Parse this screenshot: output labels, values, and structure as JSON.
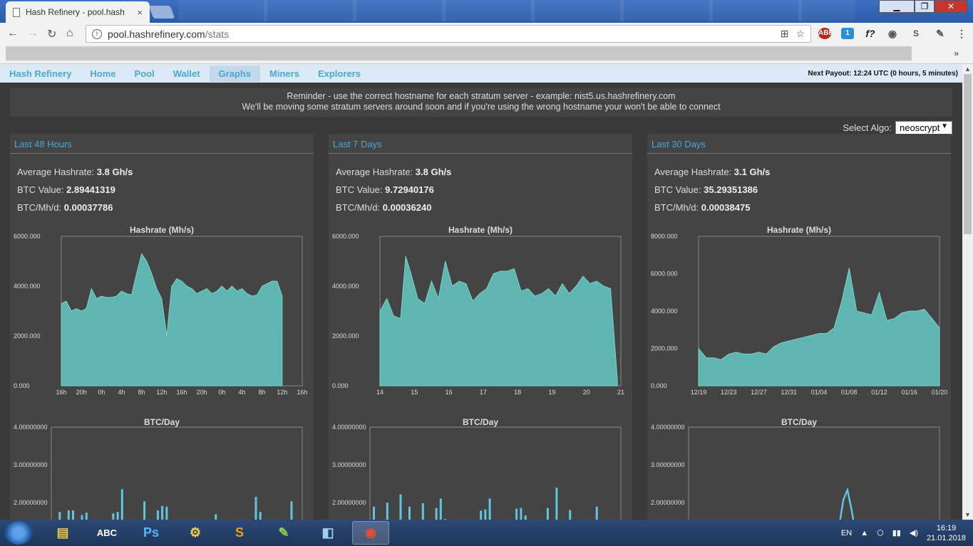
{
  "browser": {
    "tab_title": "Hash Refinery - pool.hash",
    "tab_close": "×",
    "url_host": "pool.hashrefinery.com",
    "url_path": "/stats",
    "bookmarks_overflow": "»"
  },
  "nav": {
    "brand": "Hash Refinery",
    "items": [
      "Home",
      "Pool",
      "Wallet",
      "Graphs",
      "Miners",
      "Explorers"
    ],
    "active": "Graphs",
    "payout": "Next Payout: 12:24 UTC (0 hours, 5 minutes)"
  },
  "reminder": {
    "line1": "Reminder - use the correct hostname for each stratum server - example: nist5.us.hashrefinery.com",
    "line2": "We'll be moving some stratum servers around soon and if you're using the wrong hostname your won't be able to connect"
  },
  "algo": {
    "label": "Select Algo:",
    "value": "neoscrypt",
    "arrow": "▼"
  },
  "panels": [
    {
      "title": "Last 48 Hours",
      "avg_label": "Average Hashrate:",
      "avg_value": "3.8 Gh/s",
      "btc_label": "BTC Value:",
      "btc_value": "2.89441319",
      "mhd_label": "BTC/Mh/d:",
      "mhd_value": "0.00037786"
    },
    {
      "title": "Last 7 Days",
      "avg_label": "Average Hashrate:",
      "avg_value": "3.8 Gh/s",
      "btc_label": "BTC Value:",
      "btc_value": "9.72940176",
      "mhd_label": "BTC/Mh/d:",
      "mhd_value": "0.00036240"
    },
    {
      "title": "Last 30 Days",
      "avg_label": "Average Hashrate:",
      "avg_value": "3.1 Gh/s",
      "btc_label": "BTC Value:",
      "btc_value": "35.29351386",
      "mhd_label": "BTC/Mh/d:",
      "mhd_value": "0.00038475"
    }
  ],
  "chart_data": [
    {
      "type": "area",
      "title": "Hashrate (Mh/s)",
      "ylim": [
        0,
        6000
      ],
      "yticks": [
        "0.000",
        "2000.000",
        "4000.000",
        "6000.000"
      ],
      "xticks": [
        "16h",
        "20h",
        "0h",
        "4h",
        "8h",
        "12h",
        "16h",
        "20h",
        "0h",
        "4h",
        "8h",
        "12h",
        "16h"
      ],
      "x_range": [
        0,
        48
      ],
      "x": [
        0,
        1,
        2,
        3,
        4,
        5,
        6,
        7,
        8,
        9,
        10,
        11,
        12,
        13,
        14,
        15,
        16,
        17,
        18,
        19,
        20,
        21,
        22,
        23,
        24,
        25,
        26,
        27,
        28,
        29,
        30,
        31,
        32,
        33,
        34,
        35,
        36,
        37,
        38,
        39,
        40,
        41,
        42,
        43,
        44
      ],
      "values": [
        3300,
        3400,
        3000,
        3100,
        3000,
        3100,
        3900,
        3500,
        3600,
        3550,
        3550,
        3600,
        3800,
        3700,
        3650,
        4500,
        5300,
        5000,
        4500,
        3900,
        3500,
        2000,
        4000,
        4300,
        4200,
        4000,
        3900,
        3700,
        3800,
        3900,
        3700,
        3800,
        4000,
        3800,
        4000,
        3800,
        3900,
        3700,
        3600,
        3650,
        4000,
        4100,
        4200,
        4200,
        3600
      ],
      "color": "#5fb6b0"
    },
    {
      "type": "area",
      "title": "Hashrate (Mh/s)",
      "ylim": [
        0,
        6000
      ],
      "yticks": [
        "0.000",
        "2000.000",
        "4000.000",
        "6000.000"
      ],
      "xticks": [
        "14",
        "15",
        "16",
        "17",
        "18",
        "19",
        "20",
        "21"
      ],
      "x_range": [
        14,
        21
      ],
      "x": [
        14,
        14.2,
        14.4,
        14.6,
        14.75,
        14.9,
        15.1,
        15.3,
        15.5,
        15.7,
        15.9,
        16.1,
        16.3,
        16.5,
        16.7,
        16.9,
        17.1,
        17.3,
        17.5,
        17.7,
        17.9,
        18.1,
        18.3,
        18.5,
        18.7,
        18.9,
        19.1,
        19.3,
        19.5,
        19.7,
        19.9,
        20.1,
        20.3,
        20.5,
        20.7,
        20.9
      ],
      "values": [
        3000,
        3500,
        2800,
        2700,
        5200,
        4500,
        3500,
        3300,
        4200,
        3500,
        5000,
        4000,
        4200,
        4100,
        3400,
        3700,
        3900,
        4500,
        4600,
        4600,
        4700,
        3800,
        3900,
        3600,
        3700,
        3900,
        3600,
        4100,
        3700,
        4000,
        4400,
        4100,
        4200,
        4000,
        3900,
        200
      ],
      "color": "#5fb6b0"
    },
    {
      "type": "area",
      "title": "Hashrate (Mh/s)",
      "ylim": [
        0,
        8000
      ],
      "yticks": [
        "0.000",
        "2000.000",
        "4000.000",
        "6000.000",
        "8000.000"
      ],
      "xticks": [
        "12/19",
        "12/23",
        "12/27",
        "12/31",
        "01/04",
        "01/08",
        "01/12",
        "01/16",
        "01/20"
      ],
      "x_range": [
        19,
        51
      ],
      "x": [
        19,
        20,
        21,
        22,
        23,
        24,
        25,
        26,
        27,
        28,
        29,
        30,
        31,
        32,
        33,
        34,
        35,
        36,
        37,
        38,
        39,
        40,
        41,
        42,
        43,
        44,
        45,
        46,
        47,
        48,
        49,
        50,
        51
      ],
      "values": [
        2000,
        1500,
        1500,
        1400,
        1700,
        1800,
        1700,
        1700,
        1800,
        1700,
        2100,
        2300,
        2400,
        2500,
        2600,
        2700,
        2800,
        2800,
        3100,
        4500,
        6300,
        4000,
        3900,
        3800,
        5000,
        3500,
        3600,
        3900,
        4000,
        4000,
        4100,
        3600,
        3100
      ],
      "color": "#5fb6b0"
    }
  ],
  "btc_charts": [
    {
      "type": "bar",
      "title": "BTC/Day",
      "yticks": [
        "2.00000000",
        "3.00000000",
        "4.00000000"
      ],
      "values": [
        0.28,
        0.48,
        0.18,
        0.5,
        0.5,
        0.32,
        0.44,
        0.47,
        0.06,
        0,
        0,
        0,
        0,
        0.46,
        0.48,
        0.78,
        0.2,
        0.3,
        0,
        0,
        0.62,
        0.37,
        0.3,
        0.5,
        0.56,
        0.55,
        0,
        0,
        0,
        0,
        0,
        0,
        0,
        0,
        0,
        0,
        0.45,
        0.2,
        0,
        0,
        0,
        0,
        0,
        0,
        0,
        0.68,
        0.48,
        0,
        0,
        0,
        0,
        0.18,
        0,
        0.62,
        0.12
      ]
    }
  ]
}
